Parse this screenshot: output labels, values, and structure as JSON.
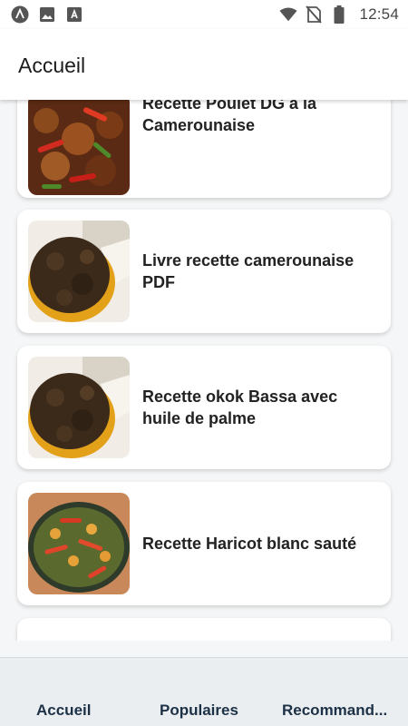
{
  "status_bar": {
    "time": "12:54",
    "icons": [
      "app-a-icon",
      "image-icon",
      "app-badge-icon",
      "wifi-icon",
      "no-sim-icon",
      "battery-icon"
    ]
  },
  "app_bar": {
    "title": "Accueil"
  },
  "recipes": [
    {
      "title": "Recette Poulet DG à la Camerounaise",
      "image": "poulet-dg-photo"
    },
    {
      "title": "Livre recette camerounaise PDF",
      "image": "okok-dish-photo"
    },
    {
      "title": "Recette okok Bassa avec huile de palme",
      "image": "okok-dish-photo"
    },
    {
      "title": "Recette Haricot blanc sauté",
      "image": "haricot-dish-photo"
    }
  ],
  "bottom_nav": {
    "items": [
      "Accueil",
      "Populaires",
      "Recommand..."
    ]
  },
  "colors": {
    "nav_text": "#1d3146",
    "nav_background": "#ebeef1",
    "page_background": "#f5f6f7"
  }
}
